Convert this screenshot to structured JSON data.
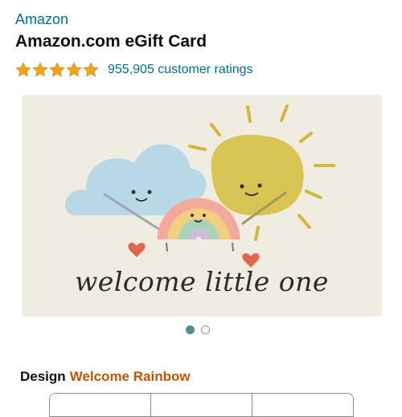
{
  "product": {
    "brand": "Amazon",
    "title": "Amazon.com eGift Card",
    "rating": {
      "stars": 5,
      "count_text": "955,905 customer ratings"
    }
  },
  "card": {
    "caption": "welcome little one",
    "carousel": {
      "total": 2,
      "active_index": 0
    }
  },
  "design": {
    "label": "Design",
    "value": "Welcome Rainbow"
  },
  "colors": {
    "link": "#007185",
    "star": "#f4a41c",
    "design_value": "#c45500",
    "card_bg": "#f1ece2"
  }
}
